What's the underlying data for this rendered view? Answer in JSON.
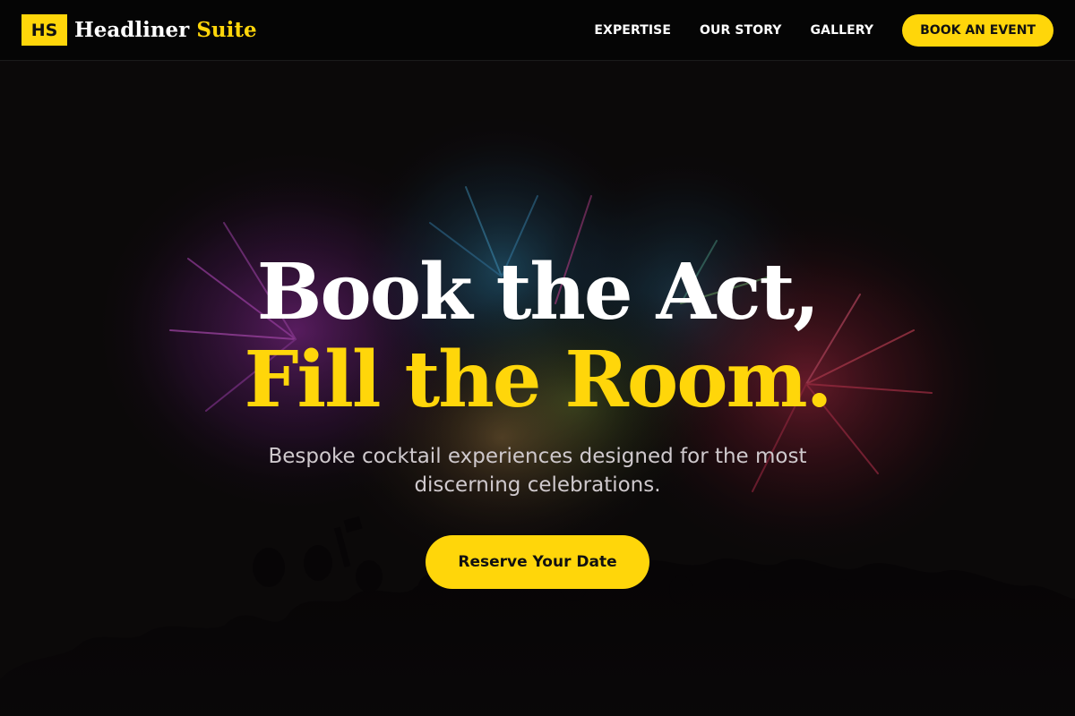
{
  "brand": {
    "mark": "HS",
    "name_main": "Headliner",
    "name_accent": "Suite"
  },
  "nav": {
    "links": [
      "EXPERTISE",
      "OUR STORY",
      "GALLERY"
    ],
    "cta_label": "BOOK AN EVENT"
  },
  "hero": {
    "headline_line1": "Book the Act,",
    "headline_line2": "Fill the Room.",
    "subheadline": "Bespoke cocktail experiences designed for the most discerning celebrations.",
    "cta_label": "Reserve Your Date"
  },
  "colors": {
    "accent": "#ffd60a",
    "header_bg": "#050505",
    "hero_bg": "#0e0b0c",
    "text_light": "#ffffff",
    "subtext": "#cfc9cd"
  }
}
